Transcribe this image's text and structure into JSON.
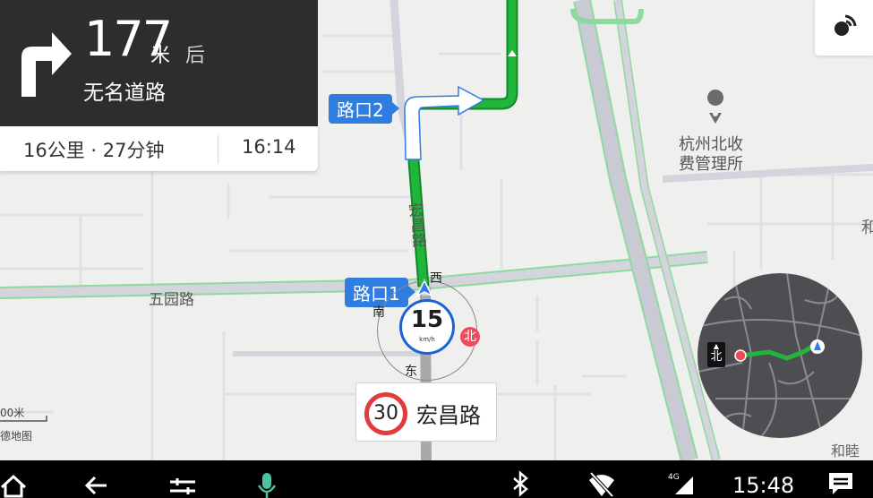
{
  "navigation": {
    "next_turn": {
      "direction": "turn-right-icon",
      "distance_value": "177",
      "distance_unit": "米",
      "distance_suffix": "后",
      "road_name": "无名道路"
    },
    "trip": {
      "remaining": "16公里 · 27分钟",
      "eta": "16:14"
    },
    "junction_callouts": [
      "路口2",
      "路口1"
    ],
    "current_speed": {
      "value": "15",
      "unit": "km/h"
    },
    "compass": {
      "west": "西",
      "south": "南",
      "east": "东",
      "north_badge": "北"
    },
    "speed_limit": {
      "value": "30",
      "road": "宏昌路"
    }
  },
  "map": {
    "labels": {
      "road_hongchang": "宏昌路",
      "road_wuyuan": "五园路",
      "poi_toll_line1": "杭州北收",
      "poi_toll_line2": "费管理所",
      "poi_hemu": "和睦朴",
      "edge_glyph": "和",
      "scale": "00米",
      "copyright": "德地图"
    },
    "colors": {
      "route": "#21b53c",
      "route_edge": "#0f8a29",
      "road": "#d3d4dc",
      "accent": "#2f7de1"
    }
  },
  "minimap": {
    "north_label": "北"
  },
  "status_bar": {
    "icons": [
      "home-icon",
      "back-icon",
      "settings-sliders-icon",
      "microphone-icon",
      "bluetooth-icon",
      "wifi-off-icon",
      "signal-icon",
      "message-icon"
    ],
    "network": "4G",
    "time": "15:48",
    "colors": {
      "microphone": "#4fc3a1"
    }
  }
}
